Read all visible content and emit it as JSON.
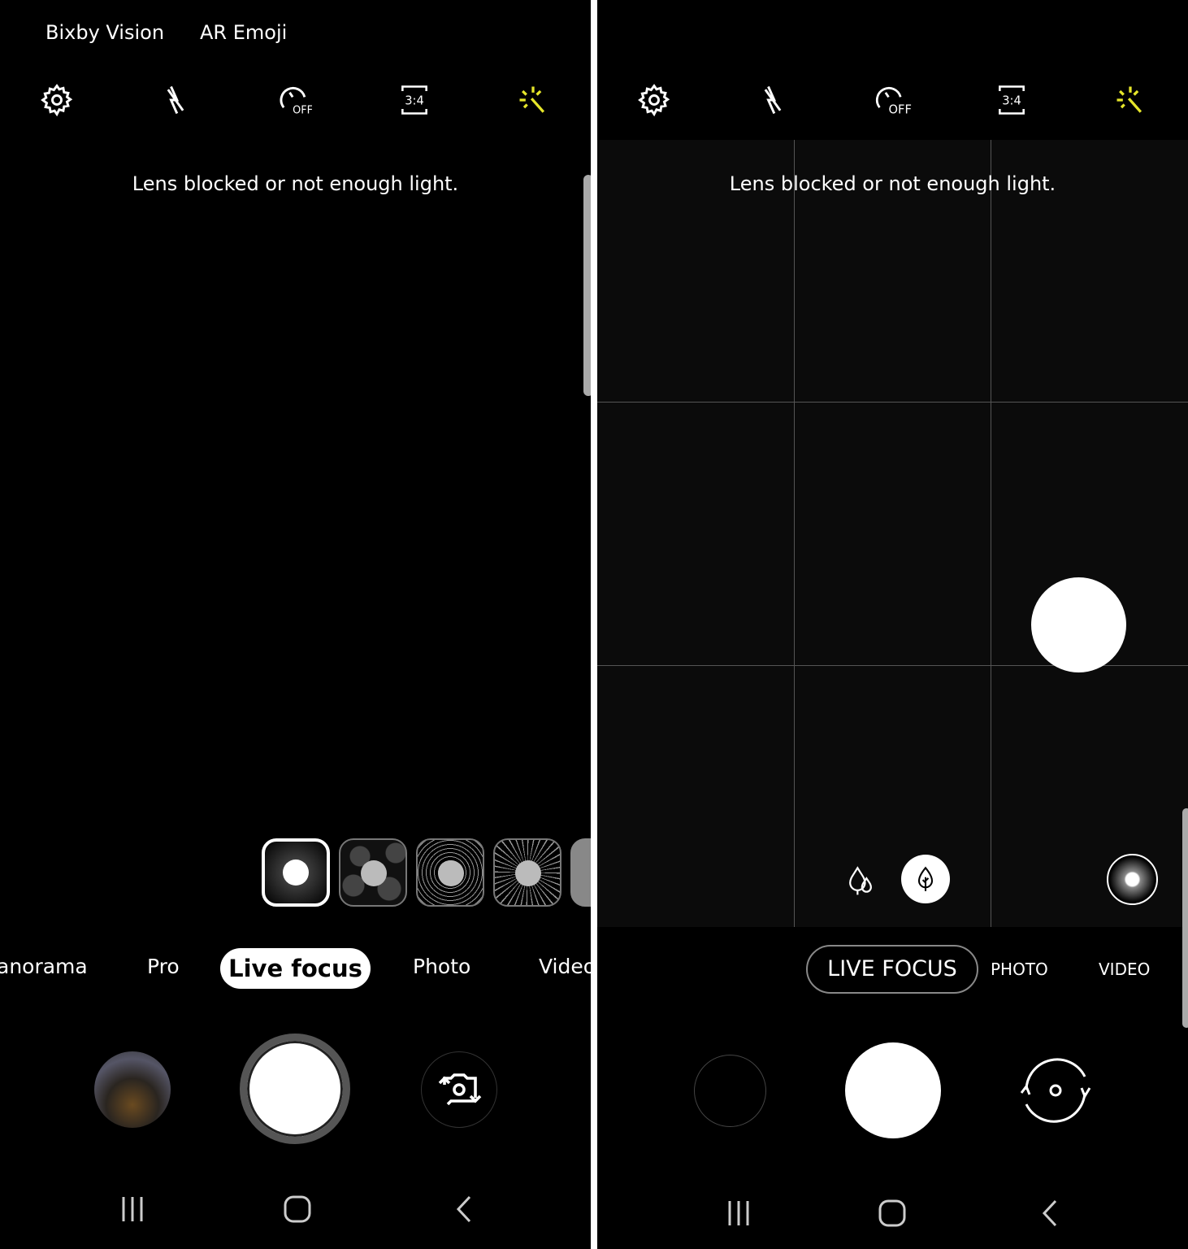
{
  "left": {
    "top_links": [
      "Bixby Vision",
      "AR Emoji"
    ],
    "toolbar_icons": [
      "settings-icon",
      "flash-off-icon",
      "timer-off-icon",
      "aspect-ratio-icon",
      "filter-effects-icon"
    ],
    "timer_label": "OFF",
    "ratio_label": "3:4",
    "message": "Lens blocked or not enough light.",
    "effects": [
      "blur",
      "big-circle",
      "color-point",
      "spin",
      "zoom"
    ],
    "selected_effect": "blur",
    "modes": [
      "anorama",
      "Pro",
      "Live focus",
      "Photo",
      "Video"
    ],
    "active_mode": "Live focus"
  },
  "right": {
    "toolbar_icons": [
      "settings-icon",
      "flash-off-icon",
      "timer-off-icon",
      "aspect-ratio-icon",
      "filter-effects-icon"
    ],
    "timer_label": "OFF",
    "ratio_label": "3:4",
    "message": "Lens blocked or not enough light.",
    "modes": [
      "LIVE FOCUS",
      "PHOTO",
      "VIDEO"
    ],
    "active_mode": "LIVE FOCUS"
  },
  "colors": {
    "accent_yellow": "#e6e62a",
    "background": "#000000"
  }
}
